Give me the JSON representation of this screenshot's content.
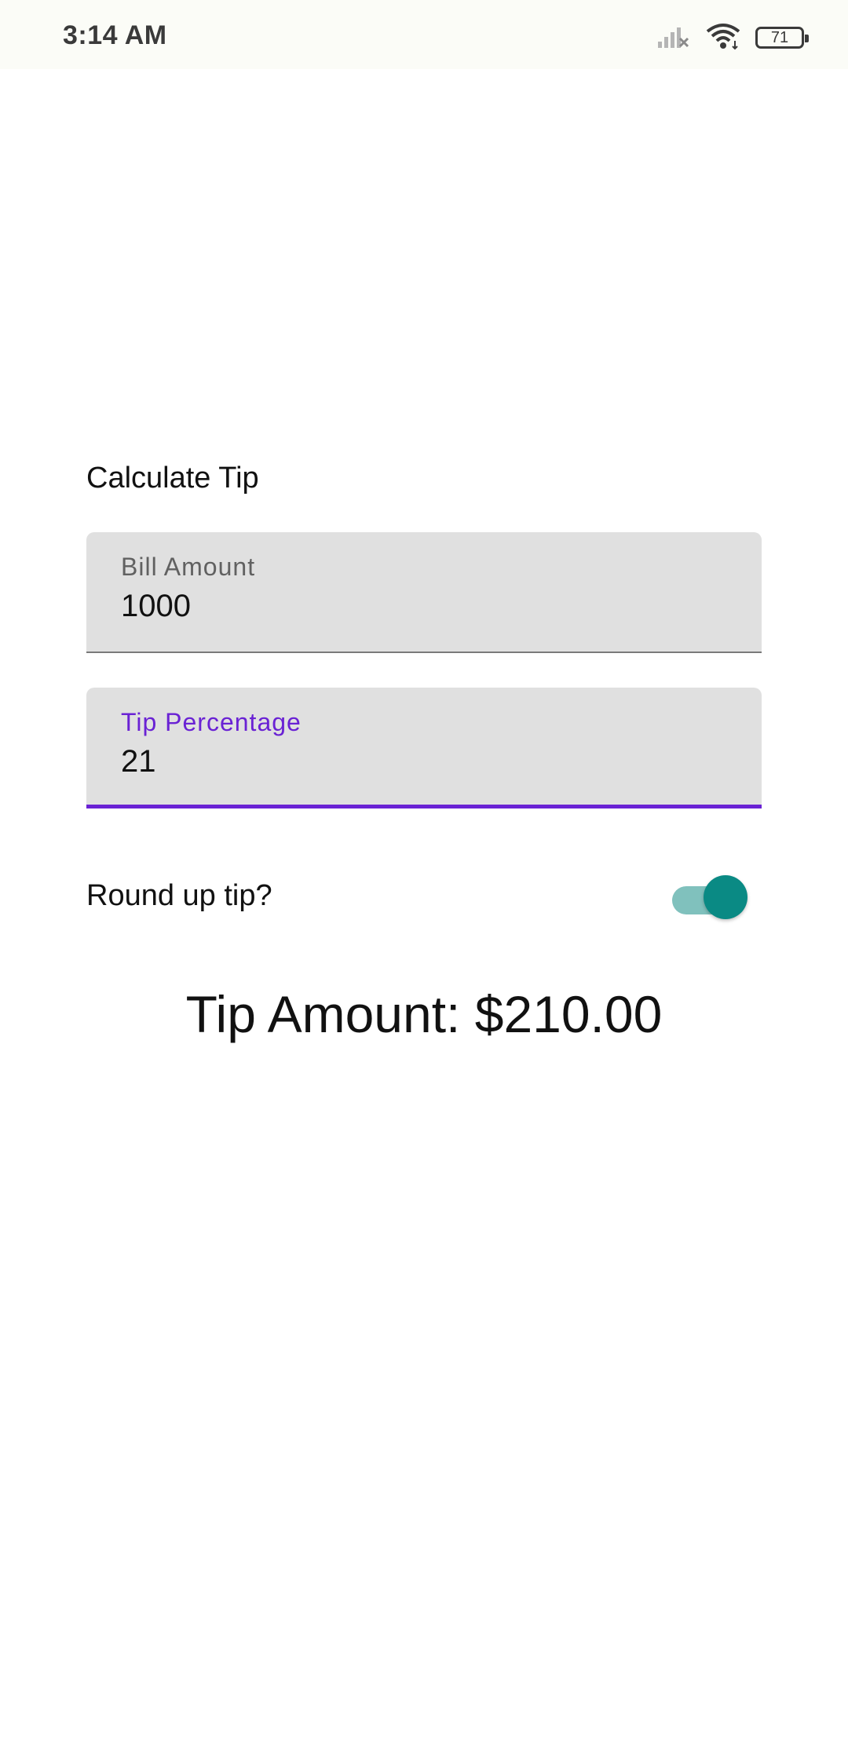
{
  "status_bar": {
    "time": "3:14 AM",
    "battery": "71",
    "icons": [
      "signal-icon",
      "wifi-icon",
      "battery-icon"
    ]
  },
  "app": {
    "title": "Calculate Tip",
    "bill_field": {
      "label": "Bill Amount",
      "value": "1000"
    },
    "tip_field": {
      "label": "Tip Percentage",
      "value": "21",
      "focused": true,
      "accent_color": "#6a22d4"
    },
    "round_up": {
      "label": "Round up tip?",
      "checked": true,
      "thumb_color": "#0a8a84",
      "track_color": "#80c1bd"
    },
    "result": "Tip Amount: $210.00"
  }
}
